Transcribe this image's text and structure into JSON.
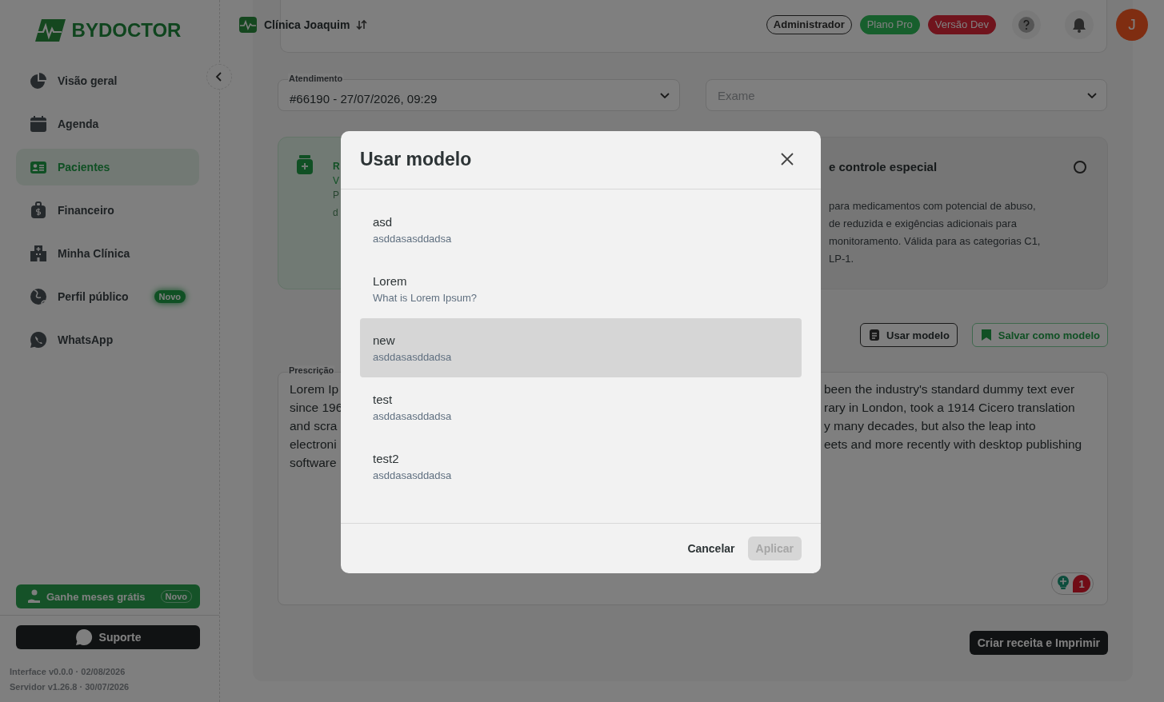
{
  "sidebar": {
    "logo_text": "BYDOCTOR",
    "items": [
      {
        "label": "Visão geral",
        "selected": false
      },
      {
        "label": "Agenda",
        "selected": false
      },
      {
        "label": "Pacientes",
        "selected": true
      },
      {
        "label": "Financeiro",
        "selected": false
      },
      {
        "label": "Minha Clínica",
        "selected": false
      },
      {
        "label": "Perfil público",
        "selected": false,
        "badge": "Novo"
      },
      {
        "label": "WhatsApp",
        "selected": false
      }
    ],
    "promo": {
      "label": "Ganhe meses grátis",
      "badge": "Novo"
    },
    "support_button": "Suporte",
    "versions": [
      "Interface v0.0.0 · 02/08/2026",
      "Servidor v1.26.8 · 30/07/2026"
    ]
  },
  "header": {
    "clinic": "Clínica Joaquim",
    "badges": [
      {
        "label": "Administrador",
        "kind": "outline"
      },
      {
        "label": "Plano Pro",
        "kind": "success"
      },
      {
        "label": "Versão Dev",
        "kind": "danger"
      }
    ],
    "avatar": "J"
  },
  "form": {
    "atendimento": {
      "label": "Atendimento",
      "value": "#66190 - 27/07/2026, 09:29"
    },
    "exame": {
      "placeholder": "Exame"
    }
  },
  "cards": [
    {
      "selected": true,
      "title": "R",
      "subtitle": "V",
      "lines": [
        "P",
        "d"
      ]
    },
    {
      "selected": false,
      "title": "e controle especial",
      "lines": [
        "para medicamentos com potencial de abuso,",
        "de reduzida e exigências adicionais para",
        "monitoramento. Válida para as categorias C1,",
        "LP-1."
      ]
    }
  ],
  "toolbar": [
    {
      "label": "Usar modelo",
      "kind": "dark"
    },
    {
      "label": "Salvar como modelo",
      "kind": "green"
    }
  ],
  "prescription": {
    "label": "Prescrição",
    "left_lines": [
      "Lorem Ip",
      "since 196",
      "and scra",
      "electroni",
      "software"
    ],
    "right_lines": [
      "been the industry's standard dummy text ever",
      "rary in London, took a 1914 Cicero translation",
      "y many decades, but also the leap into",
      "eets and more recently with desktop publishing"
    ],
    "badge_count": "1"
  },
  "primary_button": "Criar receita e Imprimir",
  "modal": {
    "title": "Usar modelo",
    "items": [
      {
        "name": "asd",
        "description": "asddasasddadsa",
        "selected": false
      },
      {
        "name": "Lorem",
        "description": "What is Lorem Ipsum?",
        "selected": false
      },
      {
        "name": "new",
        "description": "asddasasddadsa",
        "selected": true
      },
      {
        "name": "test",
        "description": "asddasasddadsa",
        "selected": false
      },
      {
        "name": "test2",
        "description": "asddasasddadsa",
        "selected": false
      }
    ],
    "cancel": "Cancelar",
    "apply": {
      "label": "Aplicar",
      "disabled": true
    }
  }
}
